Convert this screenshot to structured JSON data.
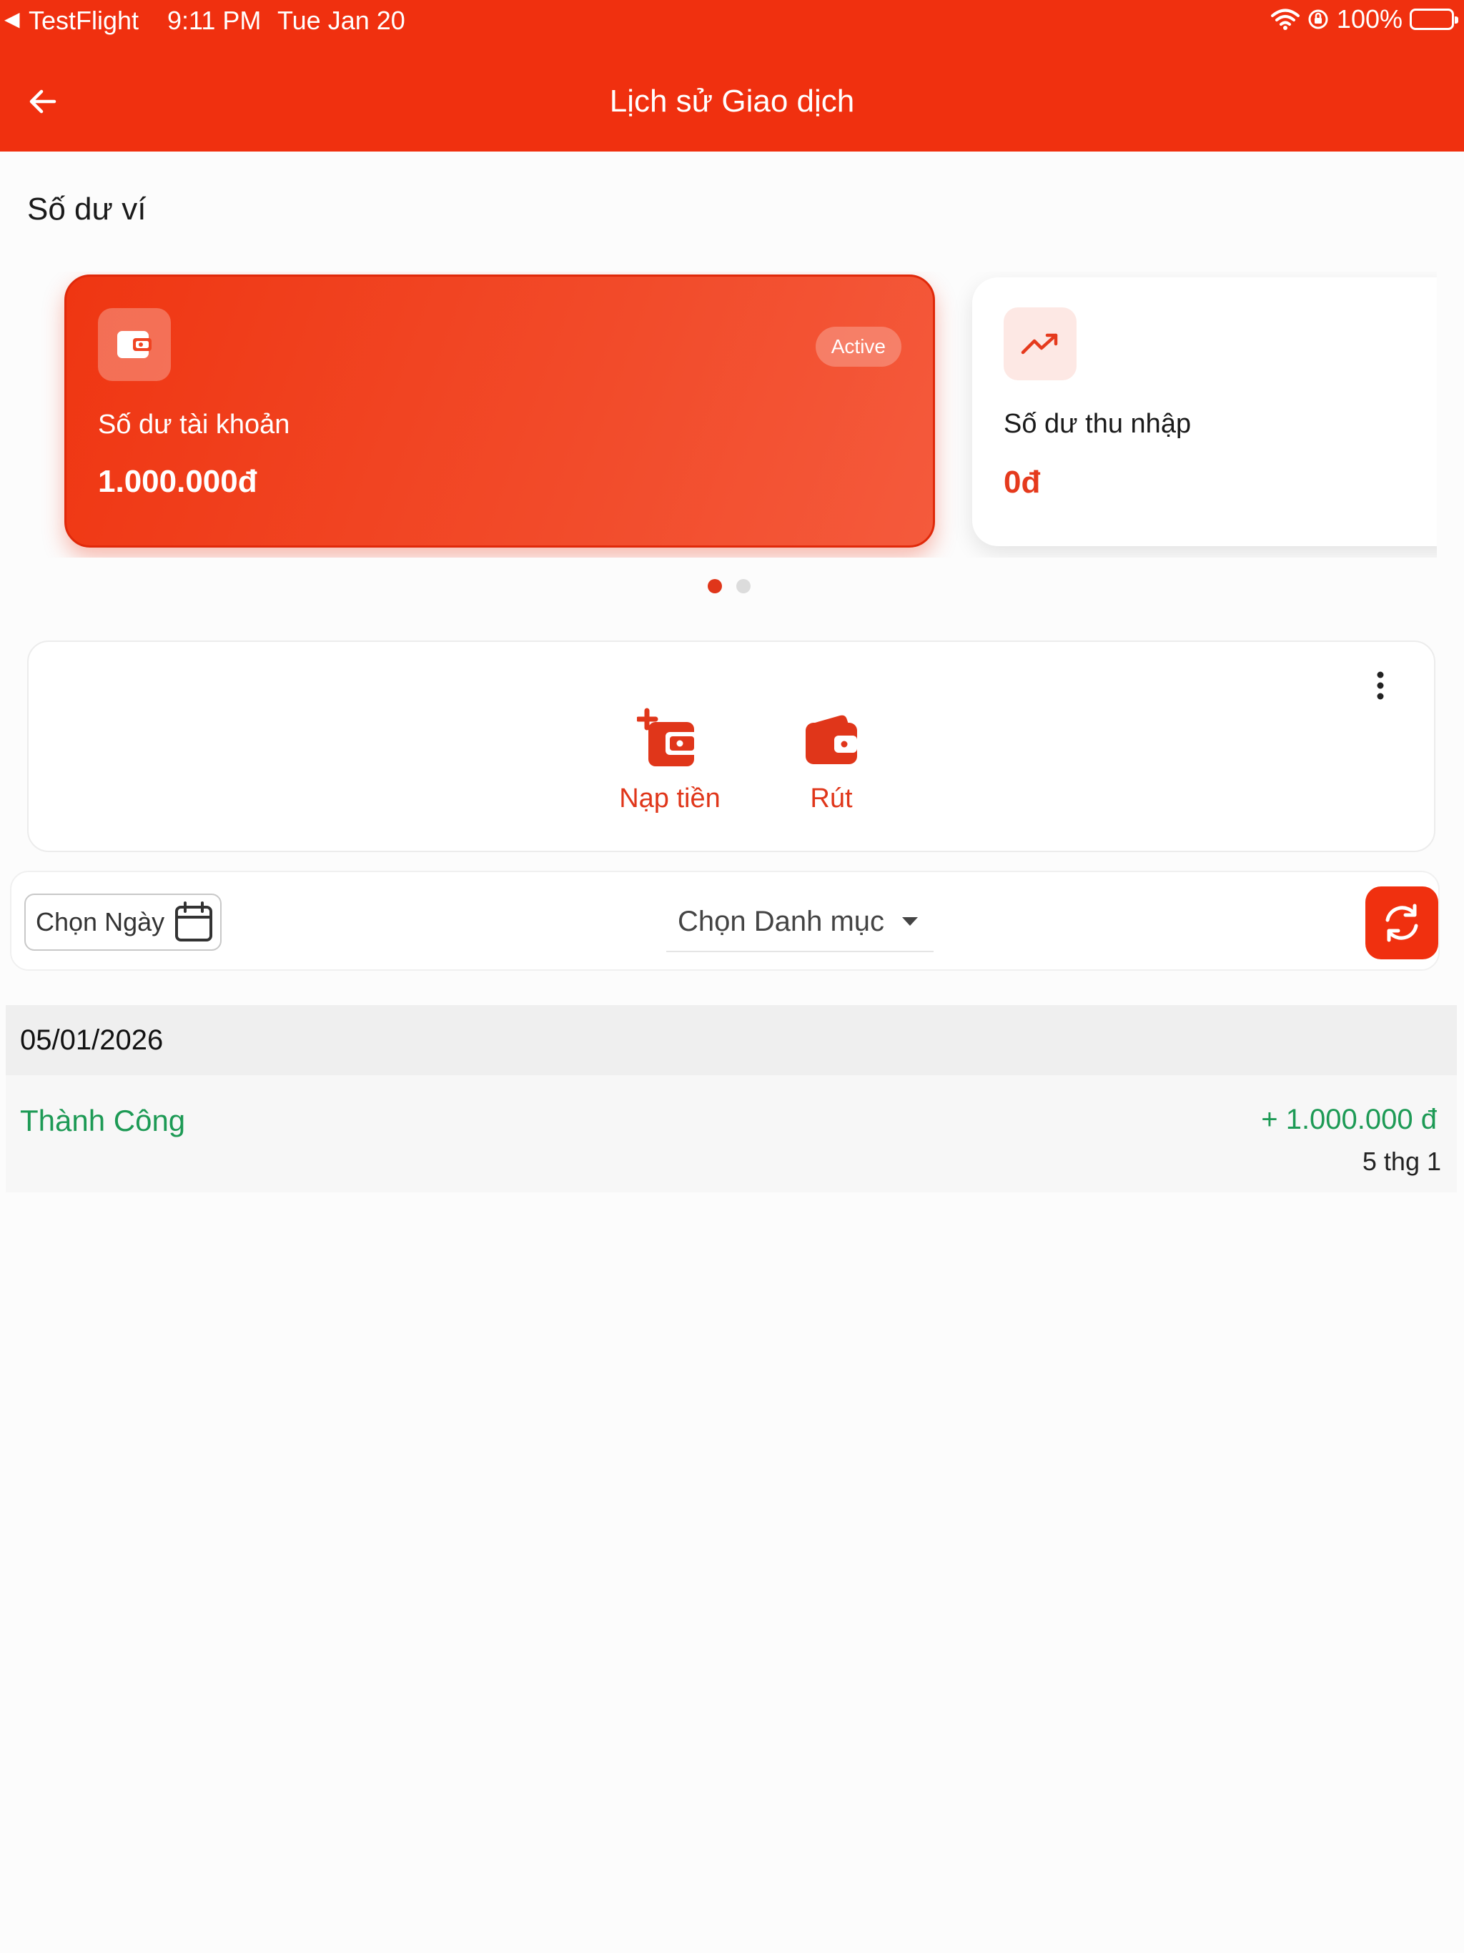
{
  "status_bar": {
    "back_app": "TestFlight",
    "time": "9:11 PM",
    "date": "Tue Jan 20",
    "battery": "100%"
  },
  "header": {
    "title": "Lịch sử Giao dịch"
  },
  "wallet": {
    "section_title": "Số dư ví",
    "cards": [
      {
        "label": "Số dư tài khoản",
        "value": "1.000.000đ",
        "badge": "Active",
        "icon": "wallet-icon"
      },
      {
        "label": "Số dư thu nhập",
        "value": "0đ",
        "icon": "trending-up-icon"
      }
    ],
    "active_page": 1,
    "page_count": 2
  },
  "actions": {
    "items": [
      {
        "label": "Nạp tiền",
        "icon": "add-wallet-icon"
      },
      {
        "label": "Rút",
        "icon": "wallet-icon"
      }
    ]
  },
  "filters": {
    "date_label": "Chọn Ngày",
    "category_label": "Chọn Danh mục"
  },
  "transactions": {
    "groups": [
      {
        "date": "05/01/2026",
        "items": [
          {
            "status": "Thành Công",
            "amount": "+ 1.000.000 đ",
            "date": "5 thg 1"
          }
        ]
      }
    ]
  },
  "colors": {
    "brand": "#f0300f",
    "success": "#1d9a55"
  }
}
